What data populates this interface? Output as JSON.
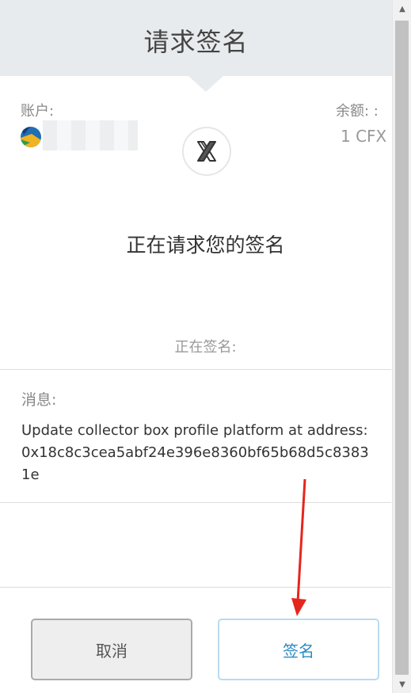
{
  "header": {
    "title": "请求签名"
  },
  "account": {
    "label": "账户:",
    "address": "",
    "balance_label": "余额: :",
    "balance_value": "1 CFX"
  },
  "request": {
    "app_logo_icon": "x-logo-icon",
    "title": "正在请求您的签名",
    "signing_label": "正在签名:"
  },
  "message": {
    "label": "消息:",
    "body": "Update collector box profile platform at address:0x18c8c3cea5abf24e396e8360bf65b68d5c83831e"
  },
  "buttons": {
    "cancel": "取消",
    "sign": "签名"
  },
  "colors": {
    "header_bg": "#e8ebee",
    "sign_text": "#2a8ac2",
    "sign_border": "#b8dcef",
    "annotation_arrow": "#e5261d"
  }
}
